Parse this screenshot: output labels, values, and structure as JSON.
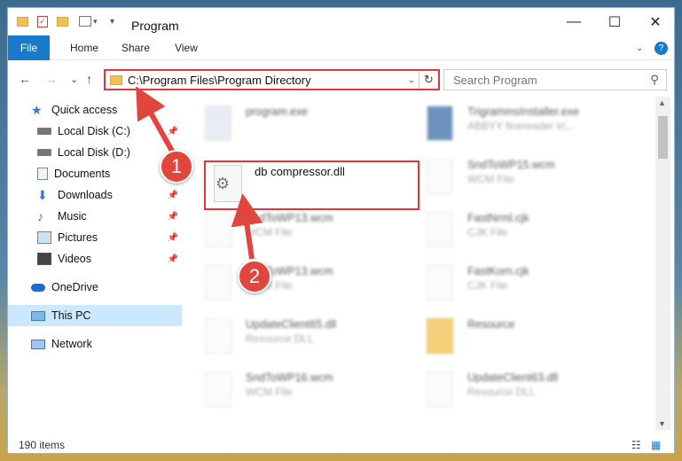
{
  "title": "Program",
  "window_controls": {
    "minimize": "—",
    "maximize": "☐",
    "close": "✕"
  },
  "ribbon": {
    "tabs": [
      "File",
      "Home",
      "Share",
      "View"
    ],
    "help": "?"
  },
  "address": {
    "path": "C:\\Program Files\\Program Directory",
    "dropdown": "⌄",
    "refresh": "↻"
  },
  "search": {
    "placeholder": "Search Program"
  },
  "nav": {
    "back": "←",
    "forward": "→",
    "recent": "⌄",
    "up": "↑",
    "items": [
      {
        "label": "Quick access",
        "icon": "star-icon",
        "pinned": false
      },
      {
        "label": "Local Disk (C:)",
        "icon": "drive-icon",
        "pinned": true
      },
      {
        "label": "Local Disk (D:)",
        "icon": "drive-icon",
        "pinned": false
      },
      {
        "label": "Documents",
        "icon": "documents-icon",
        "pinned": true
      },
      {
        "label": "Downloads",
        "icon": "download-icon",
        "pinned": true
      },
      {
        "label": "Music",
        "icon": "music-icon",
        "pinned": true
      },
      {
        "label": "Pictures",
        "icon": "pictures-icon",
        "pinned": true
      },
      {
        "label": "Videos",
        "icon": "videos-icon",
        "pinned": true
      },
      {
        "label": "OneDrive",
        "icon": "cloud-icon",
        "pinned": false
      },
      {
        "label": "This PC",
        "icon": "pc-icon",
        "pinned": false,
        "selected": true
      },
      {
        "label": "Network",
        "icon": "network-icon",
        "pinned": false
      }
    ]
  },
  "files_left": [
    {
      "name": "program.exe",
      "type": ""
    },
    {
      "name": "SndToWP13.wcm",
      "type": "WCM File"
    },
    {
      "name": "SndToWP13.wcm",
      "type": "WCM File"
    },
    {
      "name": "UpdateClient65.dll",
      "type": "Resource DLL"
    },
    {
      "name": "SndToWP16.wcm",
      "type": "WCM File"
    }
  ],
  "files_right": [
    {
      "name": "TrigrammsInstaller.exe",
      "type": "ABBYY finereader tri..."
    },
    {
      "name": "SndToWP15.wcm",
      "type": "WCM File"
    },
    {
      "name": "FastNrml.cjk",
      "type": "CJK File"
    },
    {
      "name": "FastKorn.cjk",
      "type": "CJK File"
    },
    {
      "name": "Resource",
      "type": ""
    },
    {
      "name": "UpdateClient63.dll",
      "type": "Resource DLL"
    }
  ],
  "highlighted_file": {
    "name": "db compressor.dll"
  },
  "status": {
    "count": "190 items"
  },
  "annotations": {
    "step1": "1",
    "step2": "2"
  },
  "colors": {
    "accent": "#1979ca",
    "highlight": "#e0363d",
    "badge": "#e2453d"
  }
}
